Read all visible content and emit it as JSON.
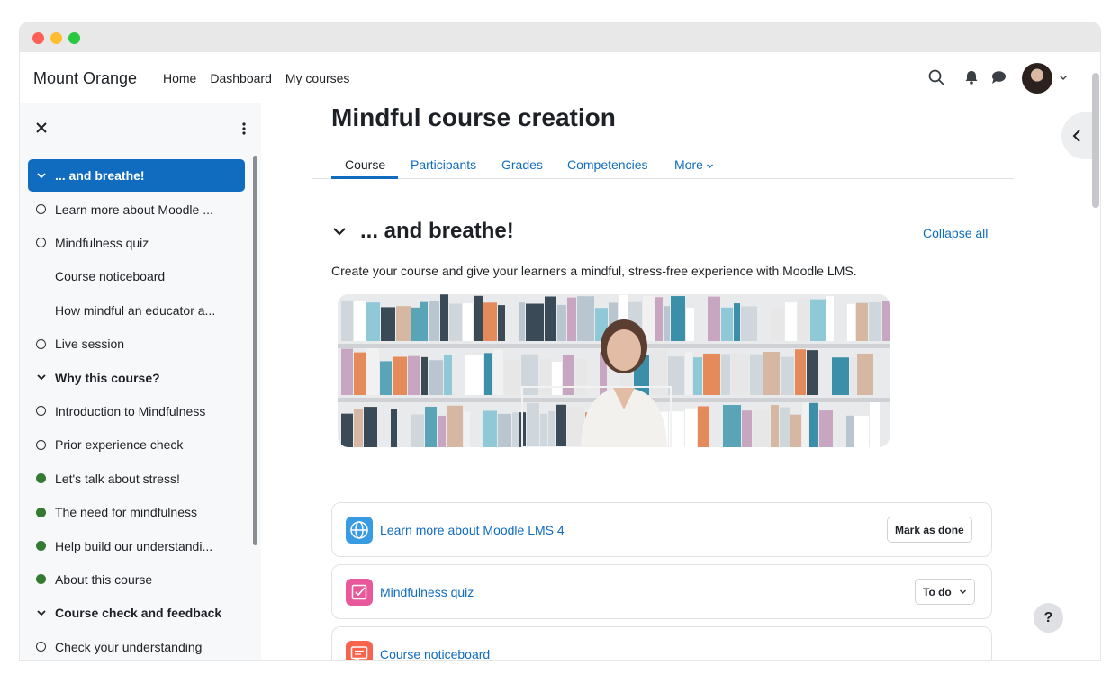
{
  "navbar": {
    "brand": "Mount Orange",
    "links": [
      "Home",
      "Dashboard",
      "My courses"
    ]
  },
  "course_index": [
    {
      "label": "... and breathe!",
      "type": "section-active"
    },
    {
      "label": "Learn more about Moodle ...",
      "type": "ring"
    },
    {
      "label": "Mindfulness quiz",
      "type": "ring"
    },
    {
      "label": "Course noticeboard",
      "type": "none"
    },
    {
      "label": "How mindful an educator a...",
      "type": "none"
    },
    {
      "label": "Live session",
      "type": "ring"
    },
    {
      "label": "Why this course?",
      "type": "section"
    },
    {
      "label": "Introduction to Mindfulness",
      "type": "ring"
    },
    {
      "label": "Prior experience check",
      "type": "ring"
    },
    {
      "label": "Let's talk about stress!",
      "type": "filled"
    },
    {
      "label": "The need for mindfulness",
      "type": "filled"
    },
    {
      "label": "Help build our understandi...",
      "type": "filled"
    },
    {
      "label": "About this course",
      "type": "filled"
    },
    {
      "label": "Course check and feedback",
      "type": "section"
    },
    {
      "label": "Check your understanding",
      "type": "ring"
    }
  ],
  "page": {
    "title": "Mindful course creation",
    "tabs": [
      "Course",
      "Participants",
      "Grades",
      "Competencies",
      "More"
    ],
    "active_tab": "Course",
    "section_title": "... and breathe!",
    "collapse_all": "Collapse all",
    "summary": "Create your course and give your learners a mindful, stress-free experience with Moodle LMS."
  },
  "activities": [
    {
      "name": "Learn more about Moodle LMS 4",
      "icon": "globe-icon",
      "color": "#399be2",
      "button": "Mark as done"
    },
    {
      "name": "Mindfulness quiz",
      "icon": "quiz-check-icon",
      "color": "#e8589b",
      "button": "To do"
    },
    {
      "name": "Course noticeboard",
      "icon": "forum-icon",
      "color": "#f7634d",
      "button": ""
    }
  ],
  "help": "?",
  "colors": {
    "primary": "#0f6cbf",
    "text": "#1d2125",
    "complete": "#357a32"
  }
}
